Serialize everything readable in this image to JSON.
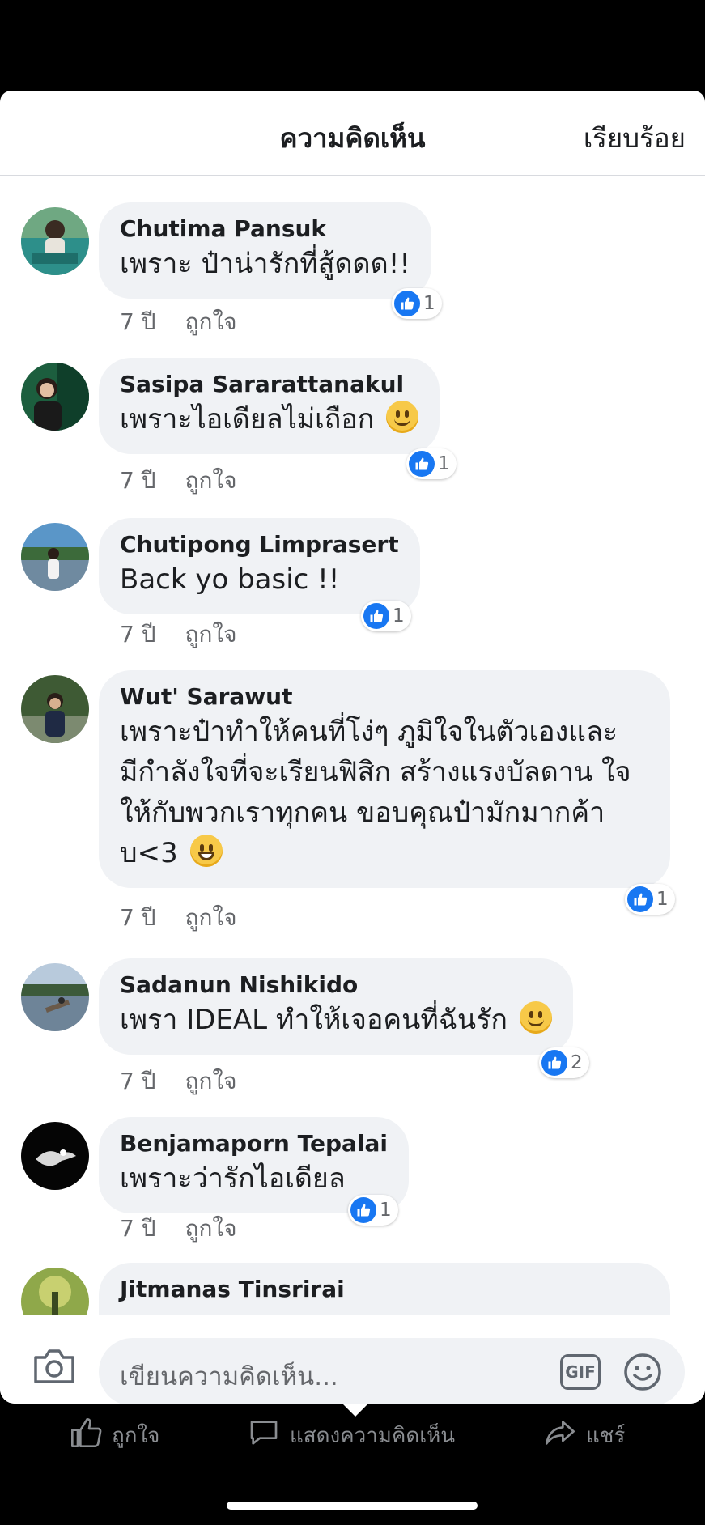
{
  "header": {
    "title": "ความคิดเห็น",
    "done_label": "เรียบร้อย"
  },
  "comments": [
    {
      "author": "Chutima Pansuk",
      "text": "เพราะ ป๋าน่ารักที่สู้ดดด!!",
      "emoji": "",
      "time": "7 ปี",
      "like_label": "ถูกใจ",
      "reactions": "1"
    },
    {
      "author": "Sasipa Sararattanakul",
      "text": "เพราะไอเดียลไม่เถือก",
      "emoji": "slightly-smiling-face",
      "time": "7 ปี",
      "like_label": "ถูกใจ",
      "reactions": "1"
    },
    {
      "author": "Chutipong Limprasert",
      "text": "Back yo basic !!",
      "emoji": "",
      "time": "7 ปี",
      "like_label": "ถูกใจ",
      "reactions": "1"
    },
    {
      "author": "Wut' Sarawut",
      "text_lines": [
        "เพราะป๋าทำให้คนที่โง่ๆ ภูมิใจในตัวเองและ",
        "มีกำลังใจที่จะเรียนฟิสิก สร้างแรงบัลดาน ใจ",
        "ให้กับพวกเราทุกคน ขอบคุณป๋ามักมากค้า",
        "บ<3"
      ],
      "emoji": "grinning-face",
      "time": "7 ปี",
      "like_label": "ถูกใจ",
      "reactions": "1"
    },
    {
      "author": "Sadanun Nishikido",
      "text": "เพรา IDEAL ทำให้เจอคนที่ฉันรัก",
      "emoji": "slightly-smiling-face",
      "time": "7 ปี",
      "like_label": "ถูกใจ",
      "reactions": "2"
    },
    {
      "author": "Benjamaporn Tepalai",
      "text": "เพราะว่ารักไอเดียล",
      "emoji": "",
      "time": "7 ปี",
      "like_label": "ถูกใจ",
      "reactions": "1"
    },
    {
      "author": "Jitmanas Tinsrirai"
    }
  ],
  "composer": {
    "placeholder": "เขียนความคิดเห็น...",
    "gif_label": "GIF"
  },
  "actions": {
    "like": "ถูกใจ",
    "comment": "แสดงความคิดเห็น",
    "share": "แชร์"
  },
  "colors": {
    "accent": "#1877f2",
    "bubble": "#f0f2f5",
    "secondary_text": "#65676b"
  }
}
